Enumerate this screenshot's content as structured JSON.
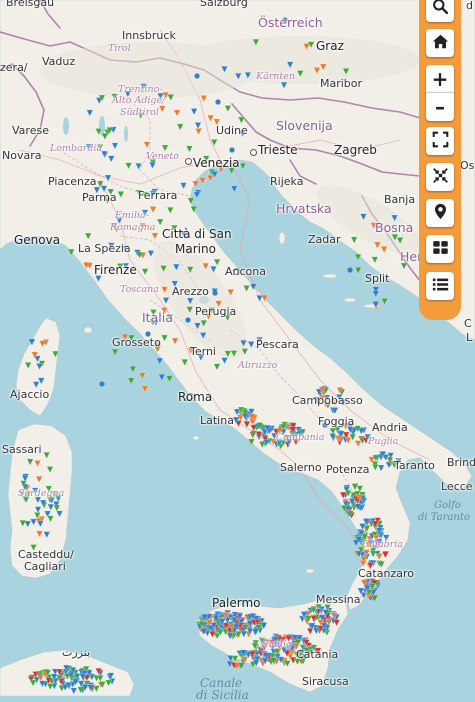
{
  "map": {
    "countries": [
      {
        "id": "austria",
        "name": "Österreich"
      },
      {
        "id": "slovenia",
        "name": "Slovenija"
      },
      {
        "id": "croatia",
        "name": "Hrvatska"
      },
      {
        "id": "italy",
        "name": "Italia"
      },
      {
        "id": "bosnia",
        "name": "Bosna"
      },
      {
        "id": "herzegovina",
        "name": "Her"
      }
    ],
    "regions": [
      {
        "id": "tirol",
        "name": "Tirol"
      },
      {
        "id": "trentino",
        "name": "Trentino-"
      },
      {
        "id": "alto-adige",
        "name": "Alto Adige/"
      },
      {
        "id": "sudtirol",
        "name": "Südtirol"
      },
      {
        "id": "karnten",
        "name": "Kärnten"
      },
      {
        "id": "lombardia",
        "name": "Lombardia"
      },
      {
        "id": "veneto",
        "name": "Veneto"
      },
      {
        "id": "emilia",
        "name": "Emilia-"
      },
      {
        "id": "romagna",
        "name": "Romagna"
      },
      {
        "id": "toscana",
        "name": "Toscana"
      },
      {
        "id": "abruzzo",
        "name": "Abruzzo"
      },
      {
        "id": "campania",
        "name": "Campania"
      },
      {
        "id": "puglia",
        "name": "Puglia"
      },
      {
        "id": "calabria",
        "name": "Calabria"
      },
      {
        "id": "sardegna",
        "name": "Sardegna"
      },
      {
        "id": "sicilia",
        "name": "Sicilia"
      }
    ],
    "seas": [
      {
        "id": "golfo-taranto",
        "line1": "Golfo",
        "line2": "di Taranto"
      },
      {
        "id": "canale-sicilia",
        "line1": "Canale",
        "line2": "di Sicilia"
      }
    ],
    "cities": [
      {
        "id": "breisgau",
        "name": "Breisgau"
      },
      {
        "id": "salzburg",
        "name": "Salzburg"
      },
      {
        "id": "innsbruck",
        "name": "Innsbruck"
      },
      {
        "id": "vaduz",
        "name": "Vaduz"
      },
      {
        "id": "graz",
        "name": "Graz"
      },
      {
        "id": "maribor",
        "name": "Maribor"
      },
      {
        "id": "udine",
        "name": "Udine"
      },
      {
        "id": "varese",
        "name": "Varese"
      },
      {
        "id": "novara",
        "name": "Novara"
      },
      {
        "id": "venezia",
        "name": "Venezia"
      },
      {
        "id": "trieste",
        "name": "Trieste"
      },
      {
        "id": "zagreb",
        "name": "Zagreb"
      },
      {
        "id": "os",
        "name": "Os"
      },
      {
        "id": "piacenza",
        "name": "Piacenza"
      },
      {
        "id": "parma",
        "name": "Parma"
      },
      {
        "id": "ferrara",
        "name": "Ferrara"
      },
      {
        "id": "rijeka",
        "name": "Rijeka"
      },
      {
        "id": "banja-luka",
        "name": "Banja Lu"
      },
      {
        "id": "genova",
        "name": "Genova"
      },
      {
        "id": "la-spezia",
        "name": "La Spezia"
      },
      {
        "id": "citta-di-san-marino",
        "name": "Città di San"
      },
      {
        "id": "marino",
        "name": "Marino"
      },
      {
        "id": "zadar",
        "name": "Zadar"
      },
      {
        "id": "firenze",
        "name": "Firenze"
      },
      {
        "id": "ancona",
        "name": "Ancona"
      },
      {
        "id": "split",
        "name": "Split"
      },
      {
        "id": "arezzo",
        "name": "Arezzo"
      },
      {
        "id": "perugia",
        "name": "Perugia"
      },
      {
        "id": "grosseto",
        "name": "Grosseto"
      },
      {
        "id": "terni",
        "name": "Terni"
      },
      {
        "id": "pescara",
        "name": "Pescara"
      },
      {
        "id": "ajaccio",
        "name": "Ajaccio"
      },
      {
        "id": "roma",
        "name": "Roma"
      },
      {
        "id": "campobasso",
        "name": "Campobasso"
      },
      {
        "id": "latina",
        "name": "Latina"
      },
      {
        "id": "foggia",
        "name": "Foggia"
      },
      {
        "id": "andria",
        "name": "Andria"
      },
      {
        "id": "sassari",
        "name": "Sassari"
      },
      {
        "id": "brindisi",
        "name": "Brind"
      },
      {
        "id": "salerno",
        "name": "Salerno"
      },
      {
        "id": "potenza",
        "name": "Potenza"
      },
      {
        "id": "taranto",
        "name": "Taranto"
      },
      {
        "id": "lecce",
        "name": "Lecce"
      },
      {
        "id": "casteddu",
        "name": "Casteddu/"
      },
      {
        "id": "cagliari",
        "name": "Cagliari"
      },
      {
        "id": "catanzaro",
        "name": "Catanzaro"
      },
      {
        "id": "palermo",
        "name": "Palermo"
      },
      {
        "id": "messina",
        "name": "Messina"
      },
      {
        "id": "catania",
        "name": "Catania"
      },
      {
        "id": "siracusa",
        "name": "Siracusa"
      },
      {
        "id": "tunis-arabic",
        "name": "بنزرت"
      },
      {
        "id": "edge-c",
        "name": "C"
      },
      {
        "id": "edge-l",
        "name": "L"
      },
      {
        "id": "zera",
        "name": "zera/"
      },
      {
        "id": "edge-d",
        "name": "d"
      }
    ],
    "marker_colors": {
      "blue": "#2f7fd3",
      "green": "#3fa83a",
      "orange": "#ef7a2e",
      "red": "#d6332b"
    },
    "colors": {
      "sea": "#a9d3de",
      "land": "#f2efe9",
      "border": "#a87aa6",
      "toolbar": "#f39c3c"
    }
  },
  "toolbar": {
    "buttons": [
      {
        "id": "search",
        "icon": "search-icon"
      },
      {
        "id": "home",
        "icon": "home-icon"
      },
      {
        "id": "zoom-in",
        "icon": "plus-icon",
        "label": "+"
      },
      {
        "id": "zoom-out",
        "icon": "minus-icon",
        "label": "–"
      },
      {
        "id": "fullscreen",
        "icon": "fullscreen-icon"
      },
      {
        "id": "fit-bounds",
        "icon": "fit-bounds-icon"
      },
      {
        "id": "locate",
        "icon": "map-marker-icon"
      },
      {
        "id": "layers",
        "icon": "grid-icon"
      },
      {
        "id": "list",
        "icon": "list-icon"
      }
    ]
  }
}
